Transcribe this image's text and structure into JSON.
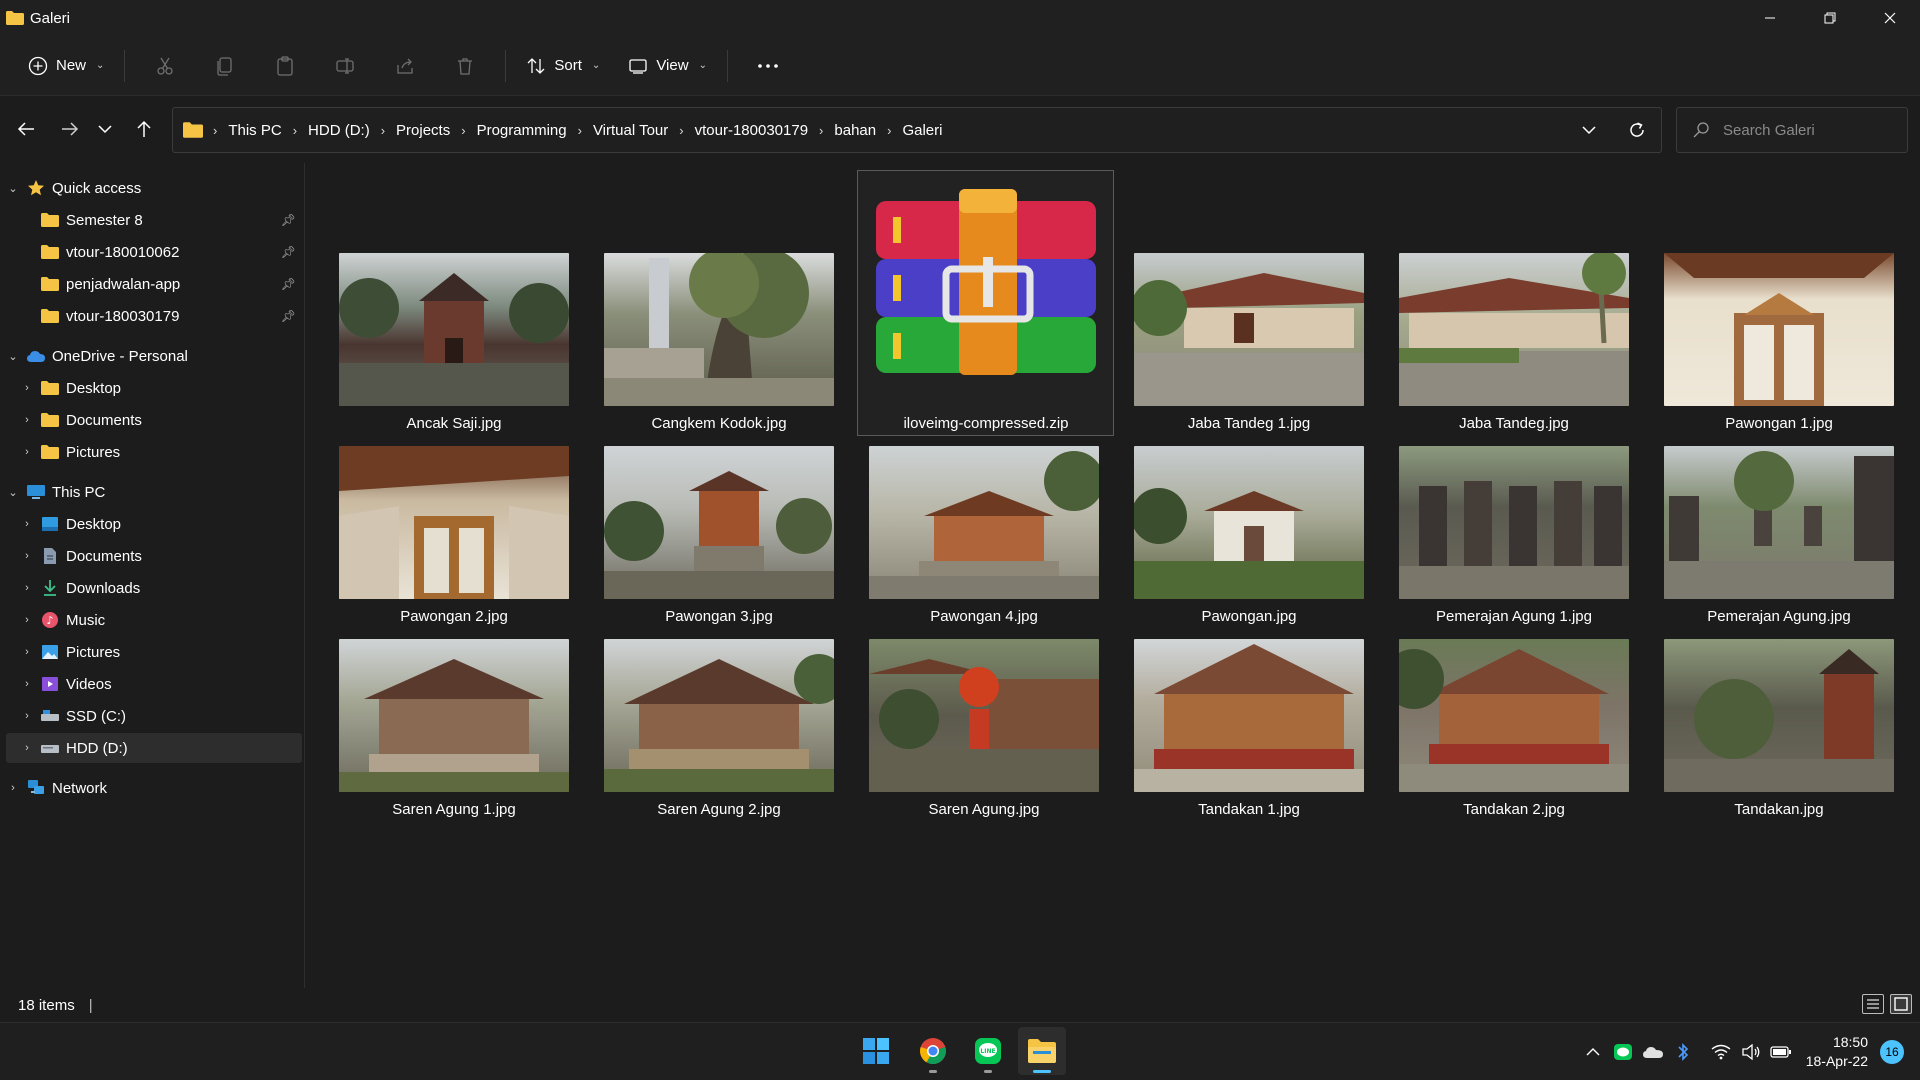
{
  "window": {
    "title": "Galeri"
  },
  "toolbar": {
    "new_label": "New",
    "sort_label": "Sort",
    "view_label": "View"
  },
  "address": {
    "breadcrumbs": [
      "This PC",
      "HDD (D:)",
      "Projects",
      "Programming",
      "Virtual Tour",
      "vtour-180030179",
      "bahan",
      "Galeri"
    ]
  },
  "search": {
    "placeholder": "Search Galeri"
  },
  "sidebar": {
    "quick_access": {
      "label": "Quick access",
      "items": [
        "Semester 8",
        "vtour-180010062",
        "penjadwalan-app",
        "vtour-180030179"
      ]
    },
    "onedrive": {
      "label": "OneDrive - Personal",
      "items": [
        "Desktop",
        "Documents",
        "Pictures"
      ]
    },
    "this_pc": {
      "label": "This PC",
      "items": [
        "Desktop",
        "Documents",
        "Downloads",
        "Music",
        "Pictures",
        "Videos",
        "SSD (C:)",
        "HDD (D:)"
      ]
    },
    "network": {
      "label": "Network"
    }
  },
  "files": [
    "Ancak Saji.jpg",
    "Cangkem Kodok.jpg",
    "iloveimg-compressed.zip",
    "Jaba Tandeg 1.jpg",
    "Jaba Tandeg.jpg",
    "Pawongan 1.jpg",
    "Pawongan 2.jpg",
    "Pawongan 3.jpg",
    "Pawongan 4.jpg",
    "Pawongan.jpg",
    "Pemerajan Agung 1.jpg",
    "Pemerajan Agung.jpg",
    "Saren Agung 1.jpg",
    "Saren Agung 2.jpg",
    "Saren Agung.jpg",
    "Tandakan 1.jpg",
    "Tandakan 2.jpg",
    "Tandakan.jpg"
  ],
  "status": {
    "items_count": "18 items"
  },
  "taskbar": {
    "time": "18:50",
    "date": "18-Apr-22",
    "notifications": "16"
  },
  "colors": {
    "accent": "#4cc2ff",
    "folder": "#f6c445",
    "background": "#1c1c1c"
  }
}
